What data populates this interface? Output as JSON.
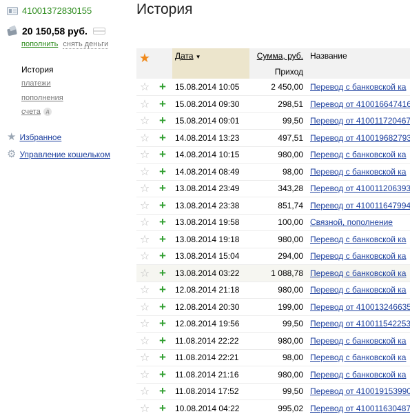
{
  "account": {
    "number": "41001372830155",
    "balance": "20 150,58 руб.",
    "topup_label": "пополнить",
    "withdraw_label": "снять деньги"
  },
  "nav": {
    "title": "История",
    "items": [
      {
        "label": "платежи"
      },
      {
        "label": "пополнения"
      },
      {
        "label": "счета",
        "badge": "д"
      }
    ],
    "favorites_label": "Избранное",
    "wallet_manage_label": "Управление кошельком"
  },
  "page": {
    "title": "История"
  },
  "table": {
    "headers": {
      "date": "Дата",
      "amount": "Сумма, руб.",
      "income": "Приход",
      "name": "Название"
    },
    "rows": [
      {
        "date": "15.08.2014 10:05",
        "amount": "2 450,00",
        "name": "Перевод с банковской ка"
      },
      {
        "date": "15.08.2014 09:30",
        "amount": "298,51",
        "name": "Перевод от 410016647416"
      },
      {
        "date": "15.08.2014 09:01",
        "amount": "99,50",
        "name": "Перевод от 410011720467"
      },
      {
        "date": "14.08.2014 13:23",
        "amount": "497,51",
        "name": "Перевод от 410019682793"
      },
      {
        "date": "14.08.2014 10:15",
        "amount": "980,00",
        "name": "Перевод с банковской ка"
      },
      {
        "date": "14.08.2014 08:49",
        "amount": "98,00",
        "name": "Перевод с банковской ка"
      },
      {
        "date": "13.08.2014 23:49",
        "amount": "343,28",
        "name": "Перевод от 410011206393"
      },
      {
        "date": "13.08.2014 23:38",
        "amount": "851,74",
        "name": "Перевод от 410011647994"
      },
      {
        "date": "13.08.2014 19:58",
        "amount": "100,00",
        "name": "Связной, пополнение"
      },
      {
        "date": "13.08.2014 19:18",
        "amount": "980,00",
        "name": "Перевод с банковской ка"
      },
      {
        "date": "13.08.2014 15:04",
        "amount": "294,00",
        "name": "Перевод с банковской ка"
      },
      {
        "date": "13.08.2014 03:22",
        "amount": "1 088,78",
        "name": "Перевод с банковской ка"
      },
      {
        "date": "12.08.2014 21:18",
        "amount": "980,00",
        "name": "Перевод с банковской ка"
      },
      {
        "date": "12.08.2014 20:30",
        "amount": "199,00",
        "name": "Перевод от 410013246635"
      },
      {
        "date": "12.08.2014 19:56",
        "amount": "99,50",
        "name": "Перевод от 410011542253"
      },
      {
        "date": "11.08.2014 22:22",
        "amount": "980,00",
        "name": "Перевод с банковской ка"
      },
      {
        "date": "11.08.2014 22:21",
        "amount": "98,00",
        "name": "Перевод с банковской ка"
      },
      {
        "date": "11.08.2014 21:16",
        "amount": "980,00",
        "name": "Перевод с банковской ка"
      },
      {
        "date": "11.08.2014 17:52",
        "amount": "99,50",
        "name": "Перевод от 410019153990"
      },
      {
        "date": "10.08.2014 04:22",
        "amount": "995,02",
        "name": "Перевод от 410011630487"
      }
    ]
  },
  "colors": {
    "link": "#1c3f9e",
    "green": "#2a8a1a",
    "income_plus": "#2f9e2f",
    "fav_star": "#f08a1c",
    "date_header_bg": "#ece5cc"
  },
  "icons": {
    "fav_header": "star-icon",
    "row_fav": "star-outline-icon",
    "income": "plus-icon",
    "account": "account-card-icon",
    "wallet": "wallet-icon",
    "card": "bank-card-icon",
    "favorites": "star-icon",
    "wallet_manage": "gear-icon"
  }
}
